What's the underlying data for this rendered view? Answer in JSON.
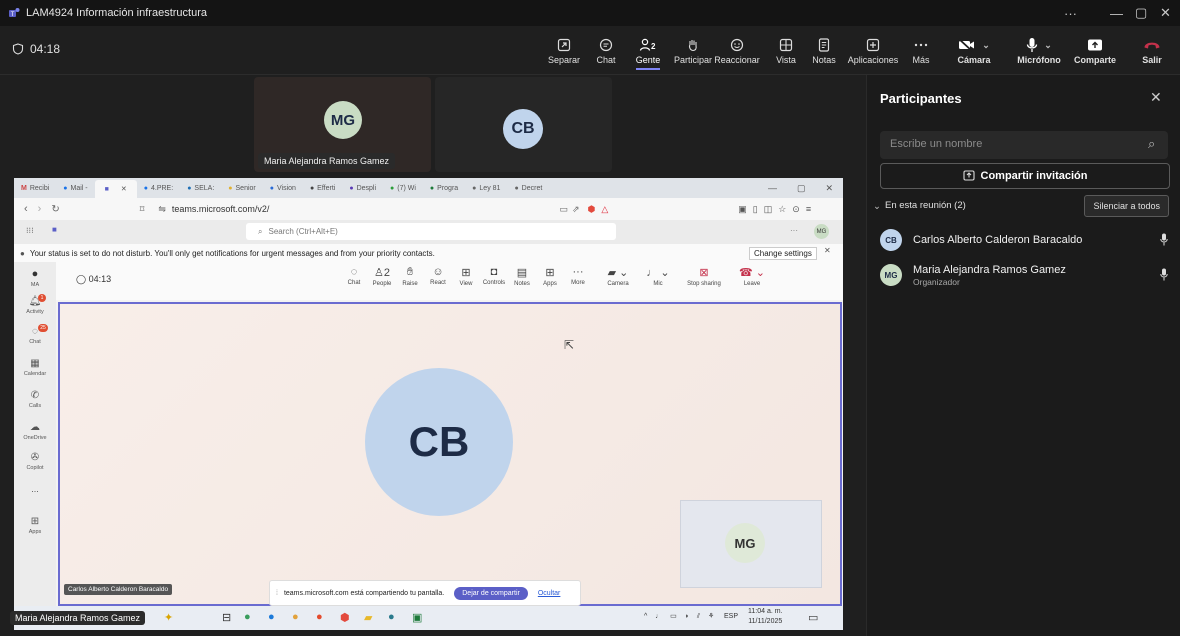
{
  "window": {
    "title": "LAM4924 Información infraestructura",
    "controls": [
      "···",
      "—",
      "▢",
      "✕"
    ]
  },
  "timer": "04:18",
  "toolbar": [
    {
      "label": "Separar",
      "icon": "popout-icon"
    },
    {
      "label": "Chat",
      "icon": "chat-icon"
    },
    {
      "label": "Gente",
      "icon": "people-icon",
      "badge": "2",
      "active": true
    },
    {
      "label": "Participar",
      "icon": "raise-hand-icon"
    },
    {
      "label": "Reaccionar",
      "icon": "react-icon"
    },
    {
      "label": "Vista",
      "icon": "view-icon"
    },
    {
      "label": "Notas",
      "icon": "notes-icon"
    },
    {
      "label": "Aplicaciones",
      "icon": "apps-icon"
    },
    {
      "label": "Más",
      "icon": "more-icon"
    },
    {
      "label": "Cámara",
      "icon": "camera-off-icon"
    },
    {
      "label": "Micrófono",
      "icon": "mic-icon"
    },
    {
      "label": "Comparte",
      "icon": "share-icon"
    },
    {
      "label": "Salir",
      "icon": "leave-icon"
    }
  ],
  "tiles": [
    {
      "initials": "MG",
      "name": "Maria Alejandra Ramos Gamez"
    },
    {
      "initials": "CB"
    }
  ],
  "shared": {
    "tabs": [
      "Recibi",
      "Mail -",
      "",
      "4.PRE:",
      "SELA:",
      "Senior",
      "Vision",
      "Efferti",
      "Despli",
      "(7) Wi",
      "Progra",
      "Ley 81",
      "Decret"
    ],
    "url": "teams.microsoft.com/v2/",
    "search_placeholder": "Search (Ctrl+Alt+E)",
    "notice": "Your status is set to do not disturb. You'll only get notifications for urgent messages and from your priority contacts.",
    "change_settings": "Change settings",
    "inner_timer": "04:13",
    "inner_toolbar": [
      "Chat",
      "People",
      "Raise",
      "React",
      "View",
      "Controls",
      "Notes",
      "Apps",
      "More",
      "Camera",
      "Mic",
      "Stop sharing",
      "Leave"
    ],
    "rail": [
      "MA",
      "Activity",
      "Chat",
      "Calendar",
      "Calls",
      "OneDrive",
      "Copilot",
      "...",
      "Apps"
    ],
    "rail_badges": [
      "1",
      "25"
    ],
    "big_initials": "CB",
    "small_initials": "MG",
    "caller_name": "Carlos Alberto Calderon Baracaldo",
    "toast_text": "teams.microsoft.com está compartiendo tu pantalla.",
    "stop_share": "Dejar de compartir",
    "hide": "Ocultar",
    "tray_lang": "ESP",
    "tray_time": "11:04 a. m.",
    "tray_date": "11/11/2025"
  },
  "panel": {
    "title": "Participantes",
    "search_placeholder": "Escribe un nombre",
    "invite": "Compartir invitación",
    "section": "En esta reunión (2)",
    "mute_all": "Silenciar a todos",
    "people": [
      {
        "initials": "CB",
        "name": "Carlos Alberto Calderon Baracaldo",
        "role": ""
      },
      {
        "initials": "MG",
        "name": "Maria Alejandra Ramos Gamez",
        "role": "Organizador"
      }
    ]
  },
  "bottom_name": "Maria Alejandra Ramos Gamez",
  "colors": {
    "accent": "#7f85f5",
    "leave": "#c4314b",
    "avatar_mg": "#c9dcc4",
    "avatar_cb": "#c0d4ec"
  }
}
